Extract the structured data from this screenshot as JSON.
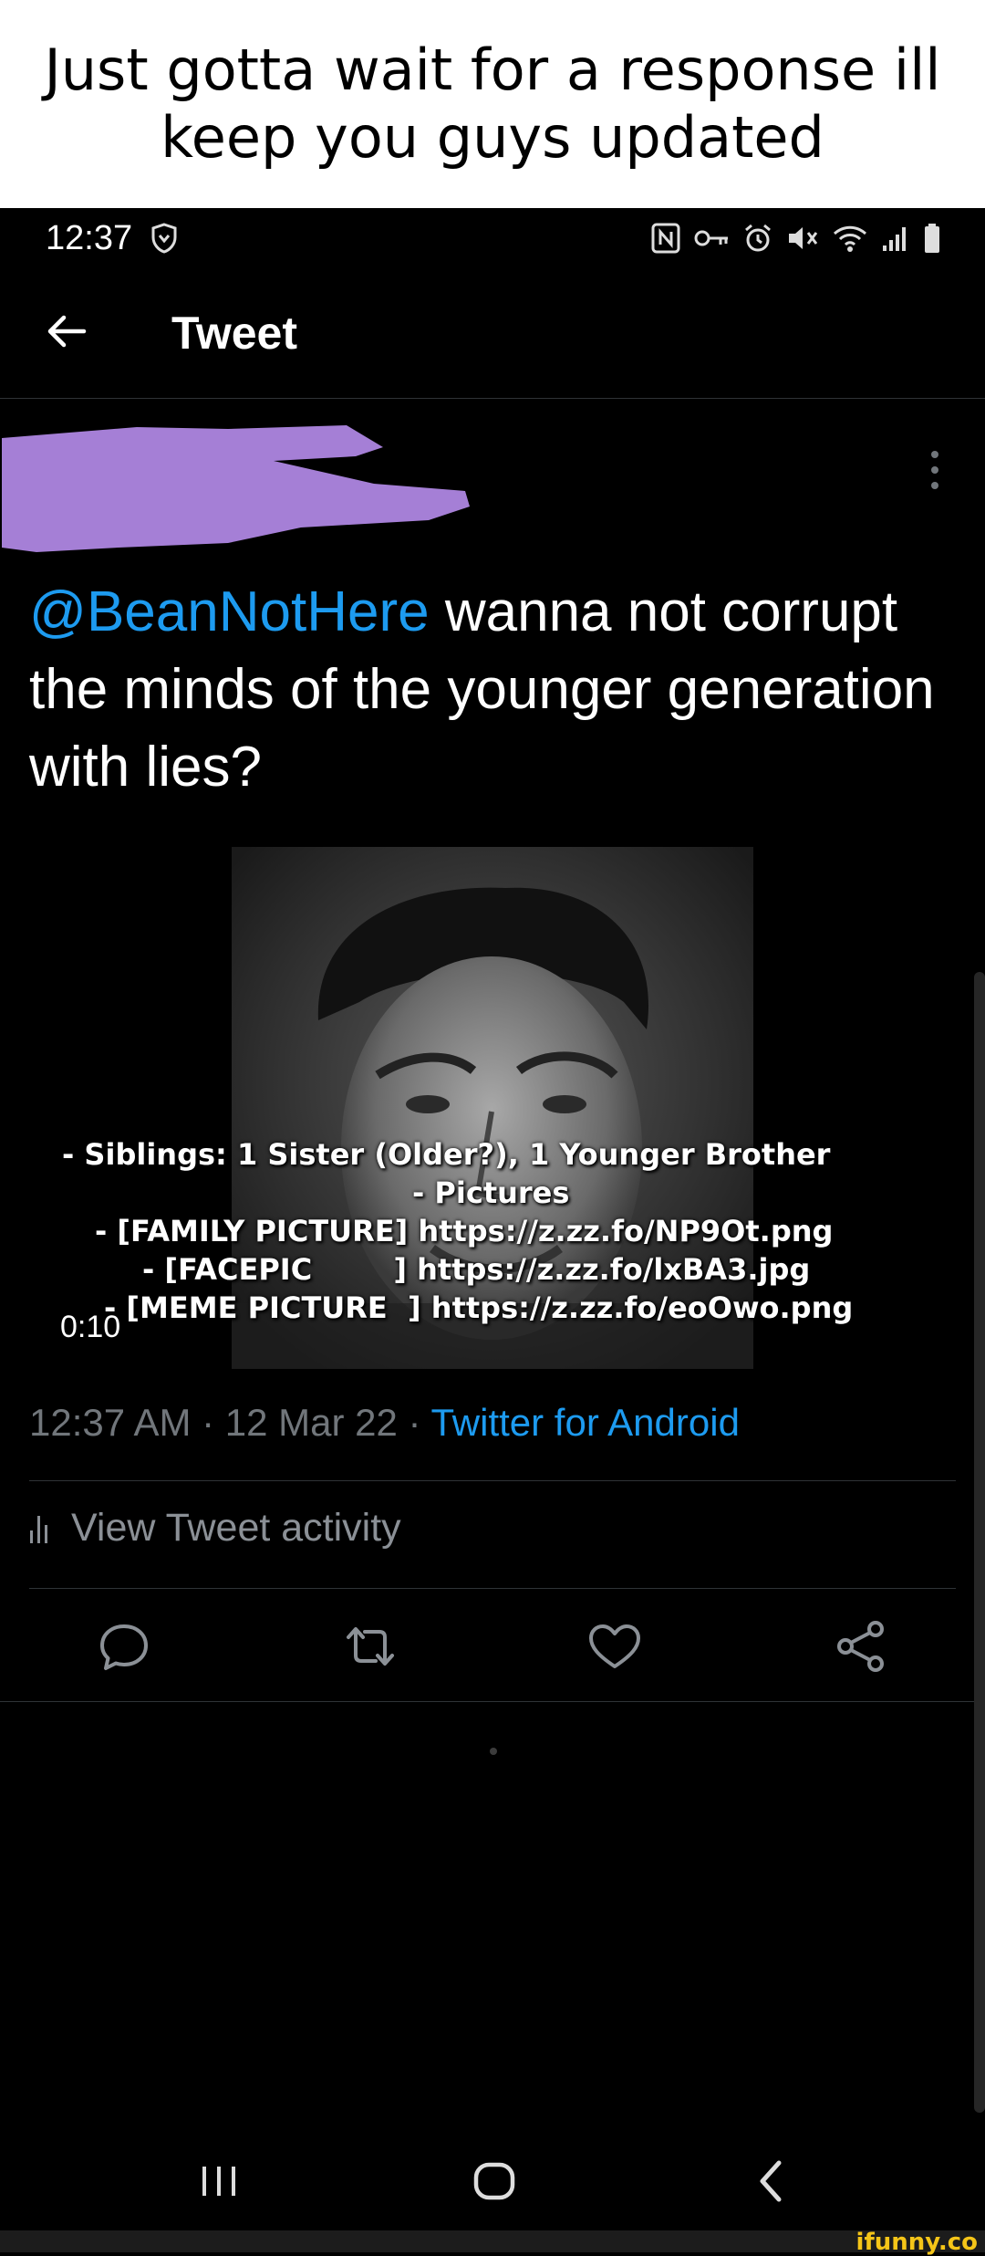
{
  "caption": {
    "text": "Just gotta wait for a response ill keep you guys updated"
  },
  "status_bar": {
    "time": "12:37",
    "icons": [
      "shield-icon",
      "nfc-icon",
      "vpn-key-icon",
      "alarm-icon",
      "mute-icon",
      "wifi-icon",
      "signal-icon",
      "battery-icon"
    ]
  },
  "header": {
    "title": "Tweet"
  },
  "tweet": {
    "mention": "@BeanNotHere",
    "body": " wanna not corrupt the minds of the younger generation with lies?",
    "media": {
      "overlay_lines": [
        "- Siblings: 1 Sister (Older?), 1 Younger Brother",
        "- Pictures",
        "- [FAMILY PICTURE] https://z.zz.fo/NP9Ot.png",
        "- [FACEPIC        ] https://z.zz.fo/lxBA3.jpg",
        "- [MEME PICTURE  ] https://z.zz.fo/eoOwo.png"
      ],
      "duration": "0:10"
    },
    "timestamp": "12:37 AM · 12 Mar 22 · ",
    "source": "Twitter for Android"
  },
  "activity": {
    "label": "View Tweet activity"
  },
  "actions": [
    "reply-icon",
    "retweet-icon",
    "like-icon",
    "share-icon"
  ],
  "watermark": "ifunny.co",
  "colors": {
    "background": "#000000",
    "accent": "#1d9bf0",
    "muted": "#71767b",
    "redaction": "#a57fd6",
    "watermark": "#f5c518"
  }
}
